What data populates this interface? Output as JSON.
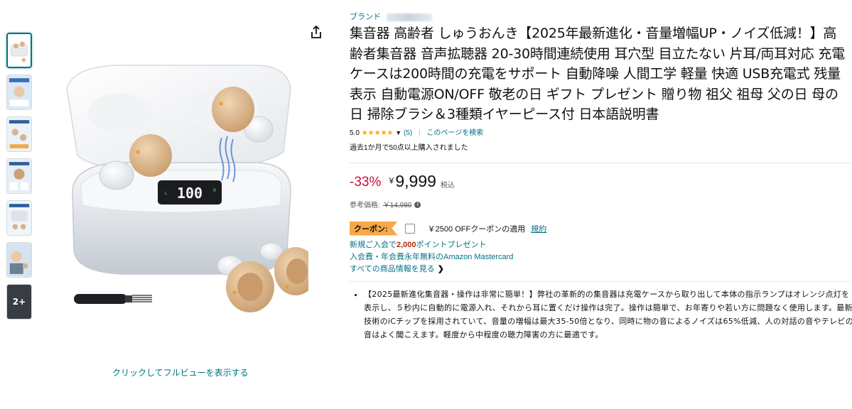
{
  "gallery": {
    "thumbnails": [
      "thumb-1",
      "thumb-2",
      "thumb-3",
      "thumb-4",
      "thumb-5",
      "thumb-6"
    ],
    "more_label": "2+",
    "display_digits": "100",
    "display_left_label": "L",
    "display_right_label": "R",
    "fullview_label": "クリックしてフルビューを表示する"
  },
  "product": {
    "brand_label": "ブランド",
    "title": "集音器 高齢者 しゅうおんき【2025年最新進化・音量増幅UP・ノイズ低減！】高齢者集音器 音声拡聴器 20-30時間連続使用 耳穴型 目立たない 片耳/両耳対応 充電ケースは200時間の充電をサポート 自動降噪 人間工学 軽量 快適 USB充電式 残量表示 自動電源ON/OFF 敬老の日 ギフト プレゼント 贈り物 祖父 祖母 父の日 母の日 掃除ブラシ＆3種類イヤーピース付 日本語説明書",
    "rating": "5.0",
    "stars": "★★★★★",
    "review_count": "(5)",
    "search_page_label": "このページを検索",
    "bought_text": "過去1か月で50点以上購入されました"
  },
  "price": {
    "discount": "-33%",
    "currency": "￥",
    "value": "9,999",
    "tax_label": "税込",
    "list_label": "参考価格:",
    "list_value": "￥14,980"
  },
  "coupon": {
    "badge": "クーポン:",
    "text": "￥2500 OFFクーポンの適用",
    "terms_link": "規約"
  },
  "promo": {
    "line1_prefix": "新規ご入会で",
    "line1_points": "2,000",
    "line1_suffix": "ポイントプレゼント",
    "line2": "入会費・年会費永年無料のAmazon Mastercard",
    "see_all": "すべての商品情報を見る"
  },
  "bullets": [
    "【2025最新進化集音器・操作は非常に簡単！】弊社の革新的の集音器は充電ケースから取り出して本体の指示ランプはオレンジ点灯を表示し、５秒内に自動的に電源入れ、それから耳に置くだけ操作は完了。操作は簡単で、お年寄りや若い方に問題なく使用します。最新技術のiCチップを採用されていて、音量の増幅は最大35-50倍となり、同時に物の音によるノイズは65%低減、人の対話の音やテレビの音はよく聞こえます。軽度から中程度の聴力障害の方に最適です。"
  ],
  "colors": {
    "link": "#007185",
    "discount": "#cc0c39",
    "star": "#ffa41c",
    "coupon_badge": "#f7a847",
    "points": "#b12704"
  }
}
